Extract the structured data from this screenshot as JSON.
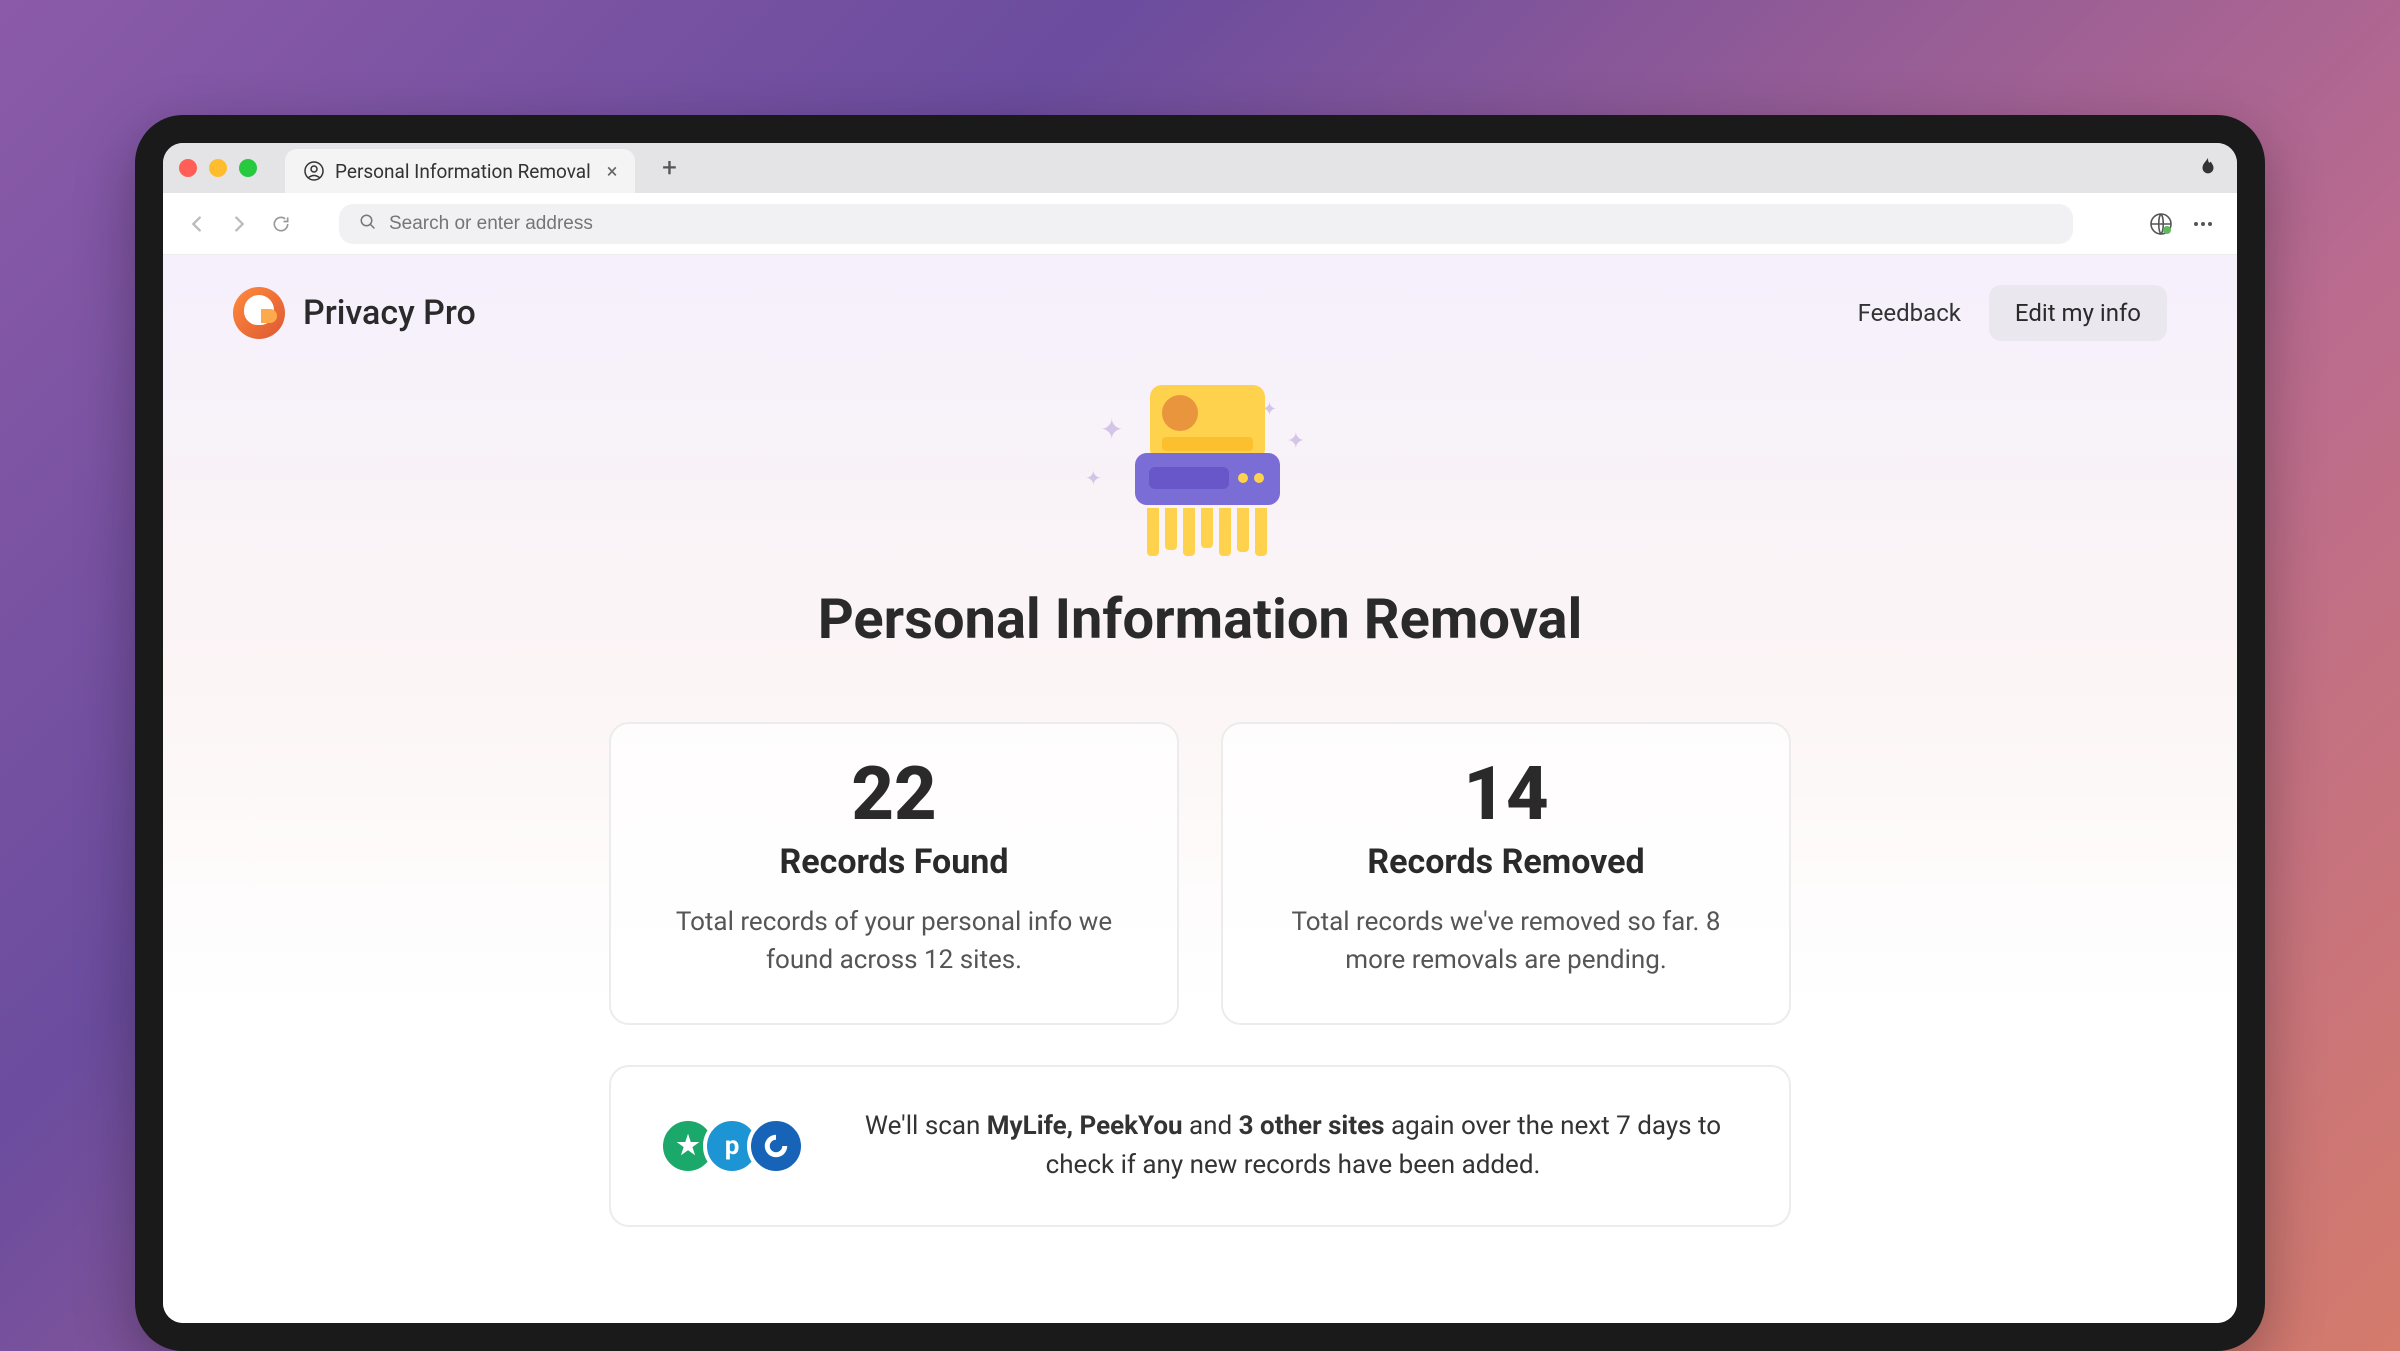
{
  "window": {
    "tab_title": "Personal Information Removal"
  },
  "toolbar": {
    "address_placeholder": "Search or enter address"
  },
  "header": {
    "brand_title": "Privacy Pro",
    "feedback_label": "Feedback",
    "edit_label": "Edit my info"
  },
  "hero": {
    "title": "Personal Information Removal"
  },
  "stats": {
    "found": {
      "number": "22",
      "label": "Records Found",
      "description": "Total records of your personal info we found across 12 sites."
    },
    "removed": {
      "number": "14",
      "label": "Records Removed",
      "description": "Total records we've removed so far. 8 more removals are pending."
    }
  },
  "scan": {
    "prefix": "We'll scan ",
    "sites_bold": "MyLife, PeekYou",
    "and": " and ",
    "others_bold": "3 other sites",
    "suffix": " again over the next 7 days to check if any new records have been added."
  }
}
